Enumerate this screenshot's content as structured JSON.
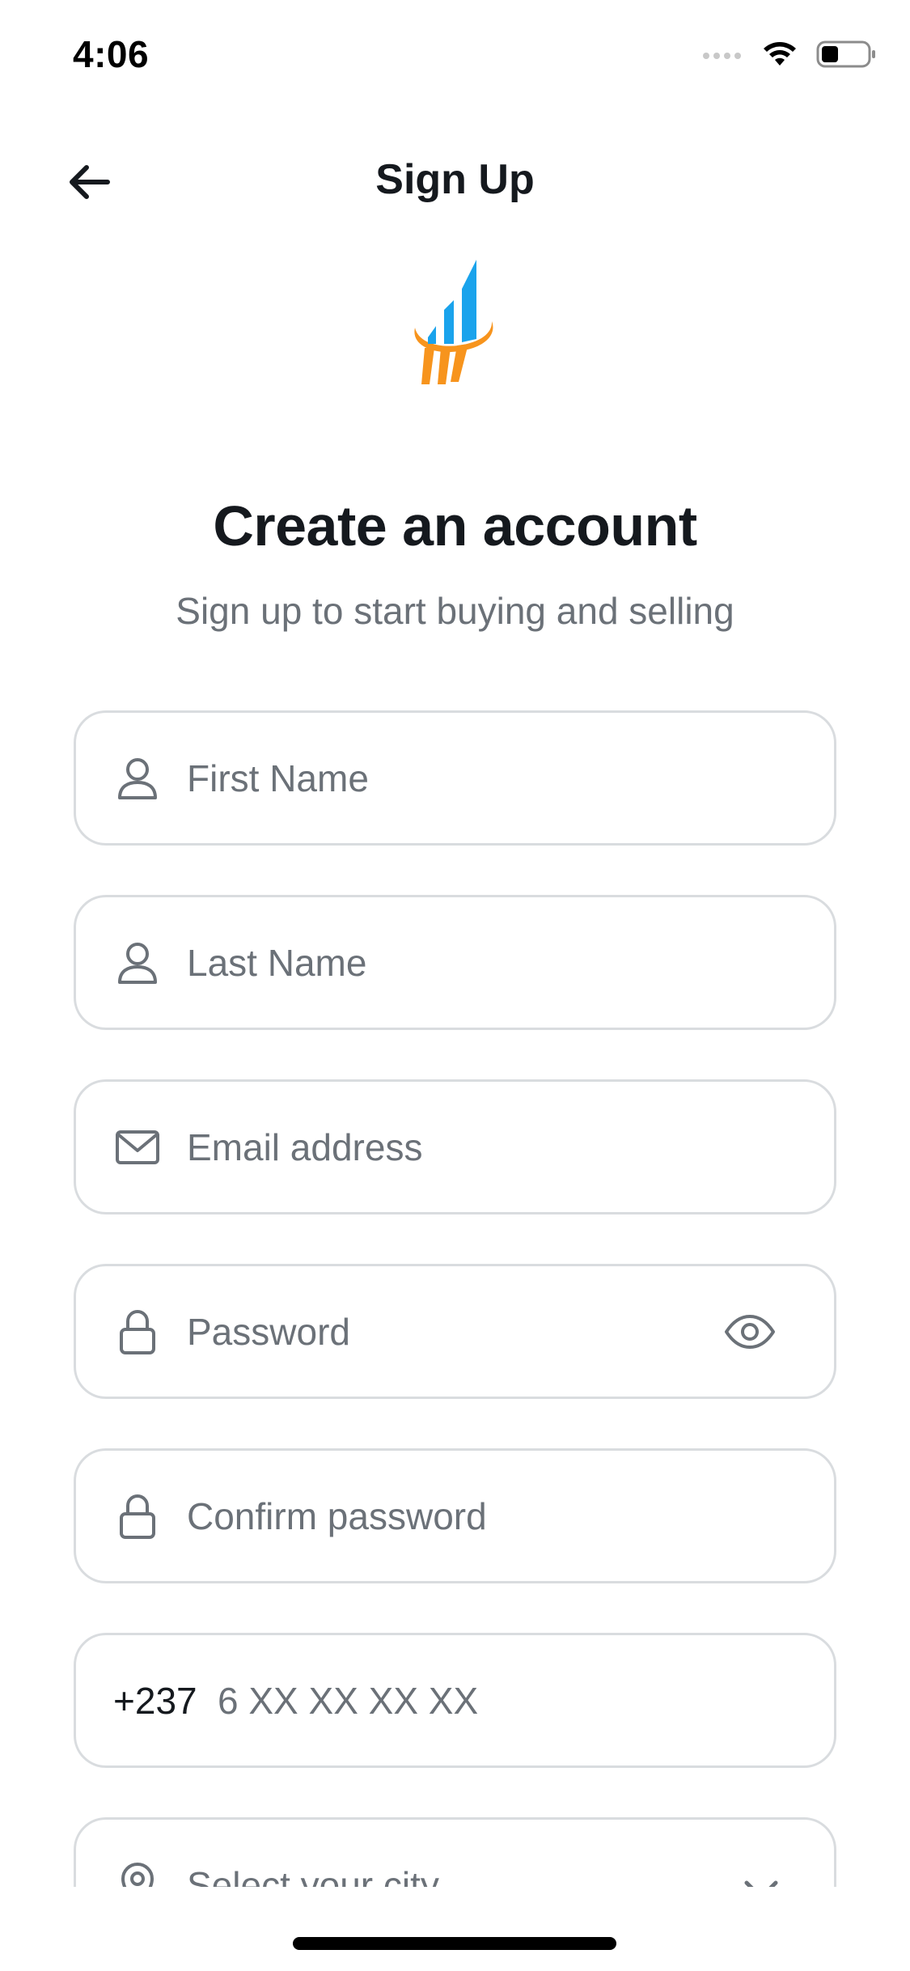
{
  "status_bar": {
    "time": "4:06",
    "icons": [
      "cellular-icon",
      "wifi-icon",
      "battery-icon"
    ]
  },
  "nav": {
    "title": "Sign Up",
    "back_icon": "arrow-left-icon"
  },
  "logo": {
    "colors": {
      "bars": "#1aa3ec",
      "swoosh": "#f7941d"
    }
  },
  "header": {
    "title": "Create an account",
    "subtitle": "Sign up to start buying and selling"
  },
  "form": {
    "first_name": {
      "placeholder": "First Name",
      "icon": "user-icon"
    },
    "last_name": {
      "placeholder": "Last Name",
      "icon": "user-icon"
    },
    "email": {
      "placeholder": "Email address",
      "icon": "mail-icon"
    },
    "password": {
      "placeholder": "Password",
      "icon": "lock-icon",
      "toggle_icon": "eye-icon"
    },
    "confirm_password": {
      "placeholder": "Confirm password",
      "icon": "lock-icon"
    },
    "phone": {
      "prefix": "+237",
      "placeholder": "6 XX XX XX XX"
    },
    "city": {
      "placeholder": "Select your city",
      "icon": "location-pin-icon",
      "dropdown_icon": "chevron-down-icon"
    }
  },
  "colors": {
    "text_primary": "#15191e",
    "text_secondary": "#6b7178",
    "field_border": "#d9dcdf",
    "background": "#ffffff"
  }
}
